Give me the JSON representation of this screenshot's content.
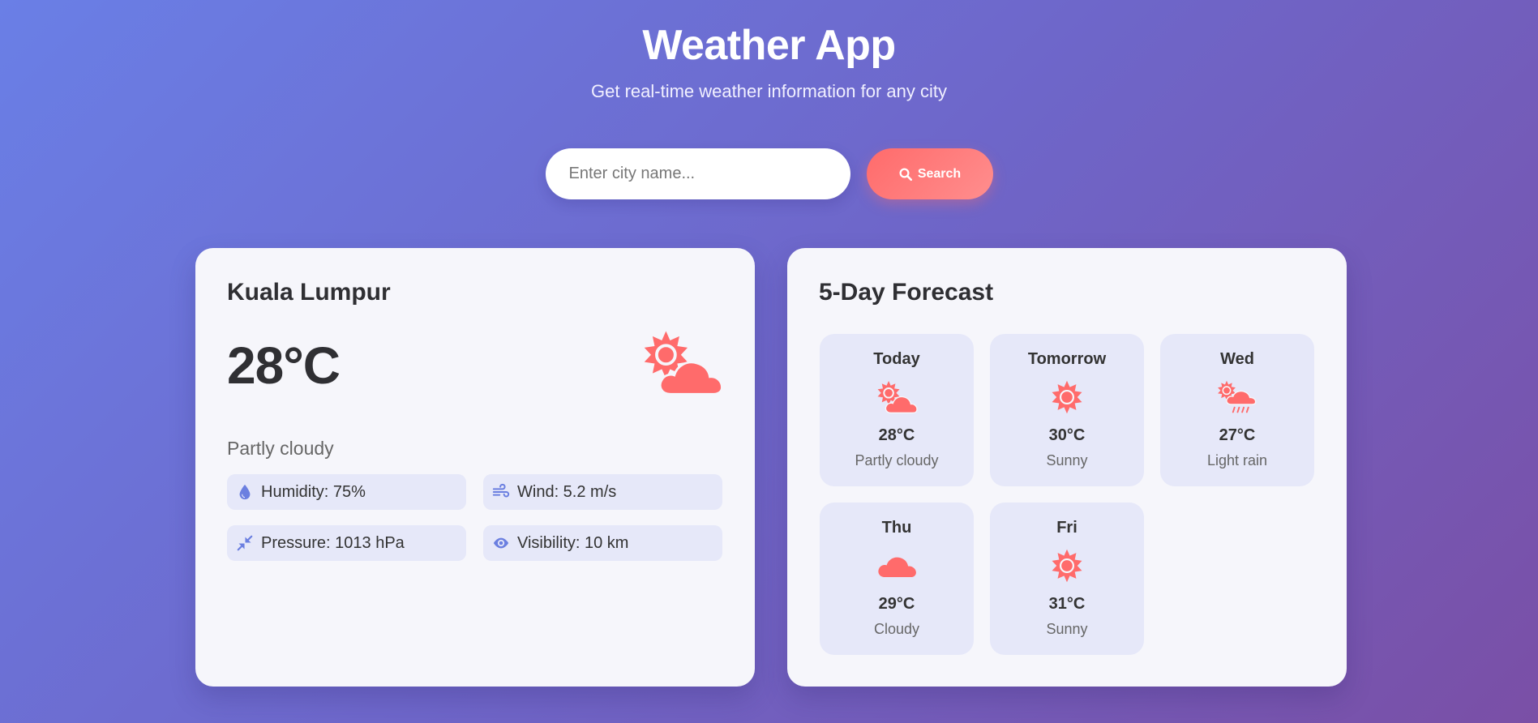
{
  "header": {
    "title": "Weather App",
    "subtitle": "Get real-time weather information for any city"
  },
  "search": {
    "placeholder": "Enter city name...",
    "value": "",
    "button_label": "Search",
    "button_icon": "search-icon"
  },
  "current": {
    "city": "Kuala Lumpur",
    "temperature": "28°C",
    "condition": "Partly cloudy",
    "icon": "partly-cloudy-icon",
    "details": {
      "humidity": "Humidity: 75%",
      "wind": "Wind: 5.2 m/s",
      "pressure": "Pressure: 1013 hPa",
      "visibility": "Visibility: 10 km"
    }
  },
  "forecast": {
    "title": "5-Day Forecast",
    "days": [
      {
        "day": "Today",
        "temp": "28°C",
        "desc": "Partly cloudy",
        "icon": "partly-cloudy-icon"
      },
      {
        "day": "Tomorrow",
        "temp": "30°C",
        "desc": "Sunny",
        "icon": "sun-icon"
      },
      {
        "day": "Wed",
        "temp": "27°C",
        "desc": "Light rain",
        "icon": "sun-rain-icon"
      },
      {
        "day": "Thu",
        "temp": "29°C",
        "desc": "Cloudy",
        "icon": "cloud-icon"
      },
      {
        "day": "Fri",
        "temp": "31°C",
        "desc": "Sunny",
        "icon": "sun-icon"
      }
    ]
  },
  "colors": {
    "accent": "#ff6b6b",
    "detail_icon": "#6b7fe0",
    "card_bg": "#f6f6fb",
    "tile_bg": "#e6e8f9"
  }
}
